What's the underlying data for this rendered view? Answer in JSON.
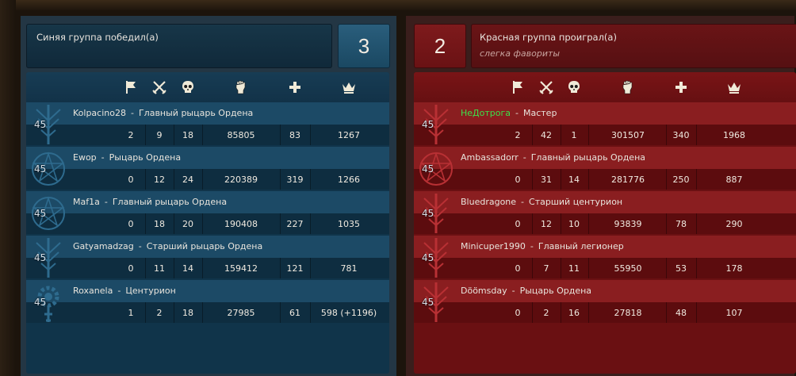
{
  "blue_team": {
    "title": "Синяя группа победил(а)",
    "score": "3",
    "color": "#1c4a66",
    "players": [
      {
        "name": "Kolpacino28",
        "rank": "Главный рыцарь Ордена",
        "level": "45",
        "flags": "2",
        "kills": "9",
        "deaths": "18",
        "damage": "85805",
        "heal": "83",
        "points": "1267",
        "emblem": "rune-icon"
      },
      {
        "name": "Ewop",
        "rank": "Рыцарь Ордена",
        "level": "45",
        "flags": "0",
        "kills": "12",
        "deaths": "24",
        "damage": "220389",
        "heal": "319",
        "points": "1266",
        "emblem": "pentagram-icon"
      },
      {
        "name": "Maf1a",
        "rank": "Главный рыцарь Ордена",
        "level": "45",
        "flags": "0",
        "kills": "18",
        "deaths": "20",
        "damage": "190408",
        "heal": "227",
        "points": "1035",
        "emblem": "pentagram-icon"
      },
      {
        "name": "Gatyamadzag",
        "rank": "Старший рыцарь Ордена",
        "level": "45",
        "flags": "0",
        "kills": "11",
        "deaths": "14",
        "damage": "159412",
        "heal": "121",
        "points": "781",
        "emblem": "rune-icon"
      },
      {
        "name": "Roxanela",
        "rank": "Центурион",
        "level": "45",
        "flags": "1",
        "kills": "2",
        "deaths": "18",
        "damage": "27985",
        "heal": "61",
        "points": "598 (+1196)",
        "emblem": "gear-icon"
      }
    ]
  },
  "red_team": {
    "title": "Красная группа проиграл(а)",
    "subtitle": "слегка фавориты",
    "score": "2",
    "color": "#8a1e20",
    "players": [
      {
        "name": "НеДотрога",
        "rank": "Мастер",
        "level": "45",
        "flags": "2",
        "kills": "42",
        "deaths": "1",
        "damage": "301507",
        "heal": "340",
        "points": "1968",
        "highlight": true,
        "emblem": "rune-icon"
      },
      {
        "name": "Ambassadorr",
        "rank": "Главный рыцарь Ордена",
        "level": "45",
        "flags": "0",
        "kills": "31",
        "deaths": "14",
        "damage": "281776",
        "heal": "250",
        "points": "887",
        "emblem": "pentagram-icon"
      },
      {
        "name": "Bluedragone",
        "rank": "Старший центурион",
        "level": "45",
        "flags": "0",
        "kills": "12",
        "deaths": "10",
        "damage": "93839",
        "heal": "78",
        "points": "290",
        "emblem": "rune-icon"
      },
      {
        "name": "Minicuper1990",
        "rank": "Главный легионер",
        "level": "45",
        "flags": "0",
        "kills": "7",
        "deaths": "11",
        "damage": "55950",
        "heal": "53",
        "points": "178",
        "emblem": "rune-icon"
      },
      {
        "name": "Döömsday",
        "rank": "Рыцарь Ордена",
        "level": "45",
        "flags": "0",
        "kills": "2",
        "deaths": "16",
        "damage": "27818",
        "heal": "48",
        "points": "107",
        "emblem": "rune-icon"
      }
    ]
  },
  "columns": [
    {
      "icon": "flag-icon",
      "label": "flags"
    },
    {
      "icon": "crossed-swords-icon",
      "label": "kills"
    },
    {
      "icon": "skull-icon",
      "label": "deaths"
    },
    {
      "icon": "fist-icon",
      "label": "damage"
    },
    {
      "icon": "plus-icon",
      "label": "heal"
    },
    {
      "icon": "crown-icon",
      "label": "points"
    }
  ]
}
